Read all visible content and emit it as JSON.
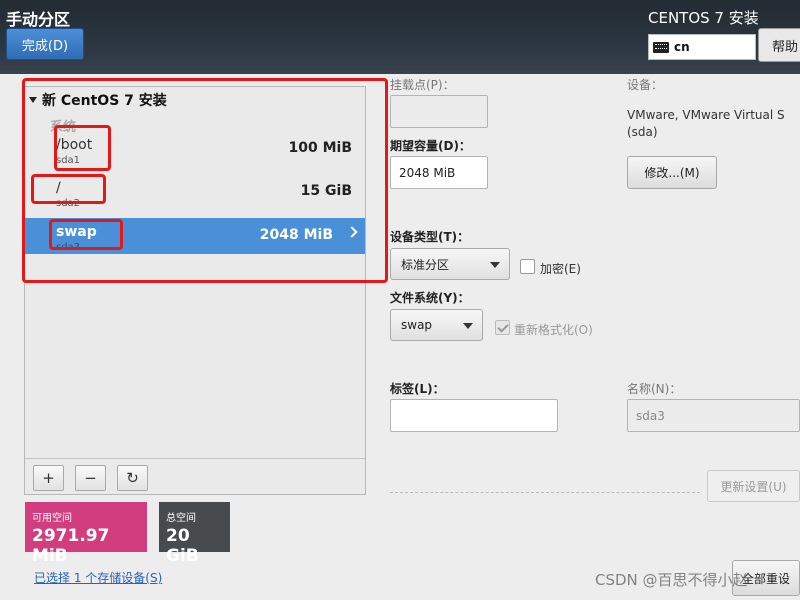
{
  "header": {
    "title": "手动分区",
    "done_button": "完成(D)",
    "product": "CENTOS 7 安装",
    "keyboard_layout": "cn",
    "help_button": "帮助"
  },
  "left_panel": {
    "install_title": "新 CentOS 7 安装",
    "system_label": "系统",
    "partitions": [
      {
        "name": "/boot",
        "device": "sda1",
        "size": "100 MiB"
      },
      {
        "name": "/",
        "device": "sda2",
        "size": "15 GiB"
      },
      {
        "name": "swap",
        "device": "sda3",
        "size": "2048 MiB"
      }
    ],
    "toolbar": {
      "add": "+",
      "remove": "−",
      "refresh": "↻"
    }
  },
  "space": {
    "available_label": "可用空间",
    "available_value": "2971.97 MiB",
    "total_label": "总空间",
    "total_value": "20 GiB"
  },
  "storage_link": "已选择 1 个存储设备(S)",
  "detail": {
    "mount_label": "挂载点(P)：",
    "desired_capacity_label": "期望容量(D)：",
    "desired_capacity_value": "2048 MiB",
    "device_label": "设备：",
    "device_name": "VMware, VMware Virtual S",
    "device_sub": "(sda)",
    "modify_button": "修改...(M)",
    "device_type_label": "设备类型(T)：",
    "device_type_value": "标准分区",
    "encrypt_label": "加密(E)",
    "filesystem_label": "文件系统(Y)：",
    "filesystem_value": "swap",
    "reformat_label": "重新格式化(O)",
    "tag_label": "标签(L)：",
    "tag_value": "",
    "name_label": "名称(N)：",
    "name_value": "sda3",
    "update_button": "更新设置(U)",
    "reset_button": "全部重设"
  },
  "watermark": "CSDN @百思不得小赵",
  "colors": {
    "selected_row": "#4a90d9",
    "available_space": "#d23e7d",
    "total_space": "#474b4e",
    "annotation": "#e31818"
  }
}
